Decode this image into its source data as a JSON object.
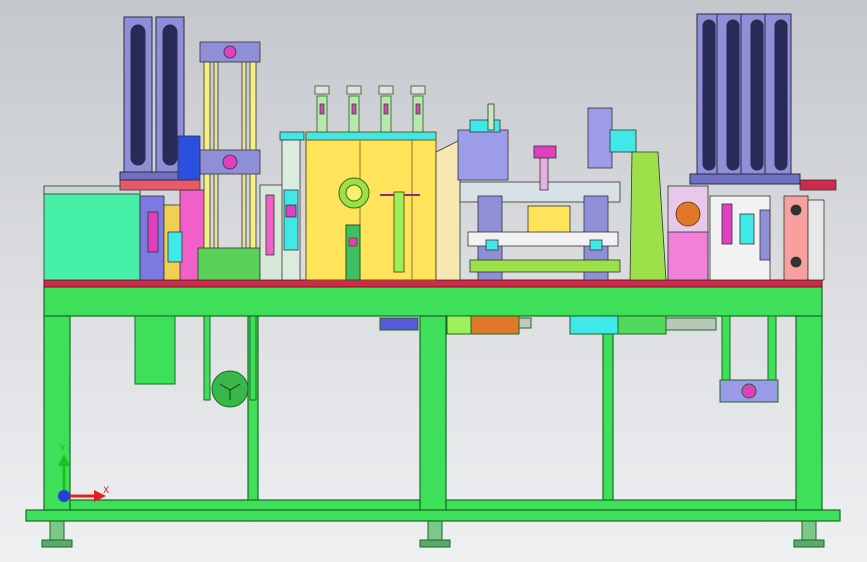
{
  "viewport": {
    "background_top": "#c4c7cc",
    "background_bottom": "#eef0f2"
  },
  "triad": {
    "x_label": "X",
    "y_label": "Y",
    "x_color": "#e02020",
    "y_color": "#20c020",
    "z_color": "#2040e0"
  },
  "colors": {
    "frame_green": "#3ee05a",
    "frame_edge": "#1a6a24",
    "top_plate": "#d02a4a",
    "cabinet_yellow": "#ffe35a",
    "hopper_lavender": "#8f8fd8",
    "magenta_parts": "#e040c0",
    "cyan_parts": "#40e8e8",
    "orange_parts": "#f08020"
  },
  "model": {
    "name": "",
    "parts": [
      "machine-frame",
      "left-hopper",
      "right-hopper",
      "left-lift-column",
      "center-cabinet",
      "pneumatic-cylinders",
      "right-station"
    ]
  }
}
